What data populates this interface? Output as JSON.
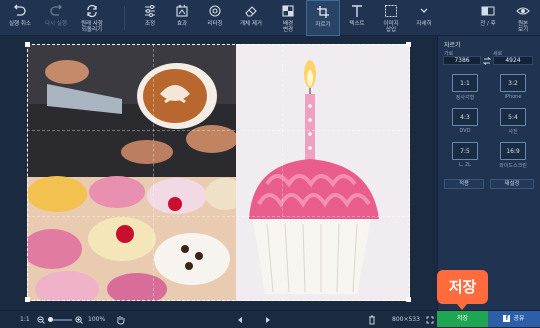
{
  "toolbar": {
    "items": [
      {
        "label": "실행 취소",
        "icon": "undo-icon"
      },
      {
        "label": "다시 실행",
        "icon": "redo-icon"
      },
      {
        "label": "원래 사항\n되돌리기",
        "icon": "revert-icon"
      },
      {
        "label": "조정",
        "icon": "sliders-icon"
      },
      {
        "label": "효과",
        "icon": "effects-icon"
      },
      {
        "label": "리터칭",
        "icon": "retouch-icon"
      },
      {
        "label": "개체 제거",
        "icon": "eraser-icon"
      },
      {
        "label": "배경\n변경",
        "icon": "background-icon"
      },
      {
        "label": "자르기",
        "icon": "crop-icon"
      },
      {
        "label": "텍스트",
        "icon": "text-icon"
      },
      {
        "label": "이미지\n삽입",
        "icon": "insert-image-icon"
      },
      {
        "label": "자세히",
        "icon": "more-icon"
      },
      {
        "label": "전 / 후",
        "icon": "before-after-icon"
      },
      {
        "label": "원본\n보기",
        "icon": "eye-icon"
      }
    ]
  },
  "side": {
    "title": "자르기",
    "width_label": "가로",
    "height_label": "세로",
    "width_value": "7386",
    "height_value": "4924",
    "ratios": [
      {
        "ratio": "1:1",
        "name": "정사각형"
      },
      {
        "ratio": "3:2",
        "name": "iPhone"
      },
      {
        "ratio": "4:3",
        "name": "DVD"
      },
      {
        "ratio": "5:4",
        "name": "사진"
      },
      {
        "ratio": "7:5",
        "name": "L, 2L"
      },
      {
        "ratio": "16:9",
        "name": "와이드스크린"
      }
    ],
    "apply_label": "적용",
    "reset_label": "재설정"
  },
  "bottom": {
    "page": "1:1",
    "zoom": "100%",
    "size": "800×533",
    "save_label": "저장",
    "share_label": "공유"
  },
  "callout": "저장",
  "colors": {
    "accent_green": "#1fa653",
    "share_blue": "#2c5fa8",
    "callout_orange": "#ff6b3d"
  }
}
